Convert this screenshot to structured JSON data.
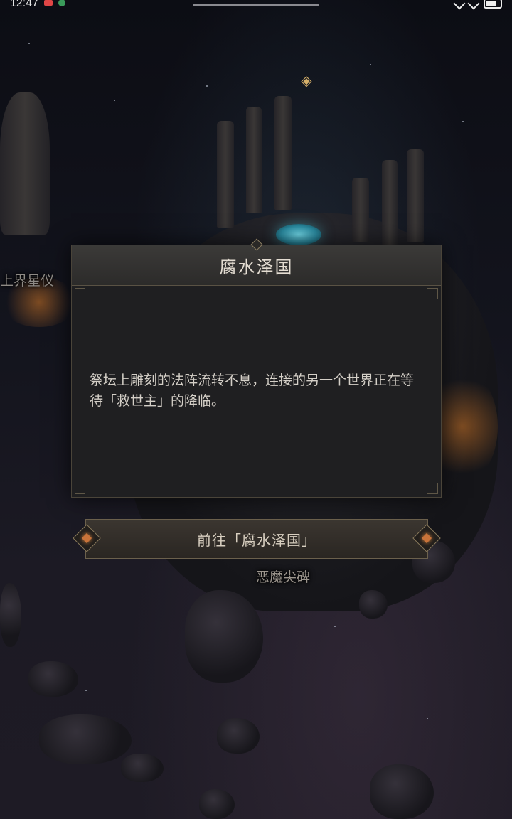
{
  "status_bar": {
    "time": "12:47"
  },
  "map": {
    "marker_icon": "◈",
    "left_location_label": "上界星仪",
    "bottom_location_label": "恶魔尖碑"
  },
  "dialog": {
    "title": "腐水泽国",
    "description": "祭坛上雕刻的法阵流转不息，连接的另一个世界正在等待「救世主」的降临。"
  },
  "action": {
    "goto_label": "前往「腐水泽国」"
  },
  "colors": {
    "dialog_bg": "#1f1f21",
    "header_bg": "#3b3a38",
    "accent_gold": "#8a7a5c",
    "accent_orange": "#c8733a",
    "portal_cyan": "#6fd6e6"
  }
}
